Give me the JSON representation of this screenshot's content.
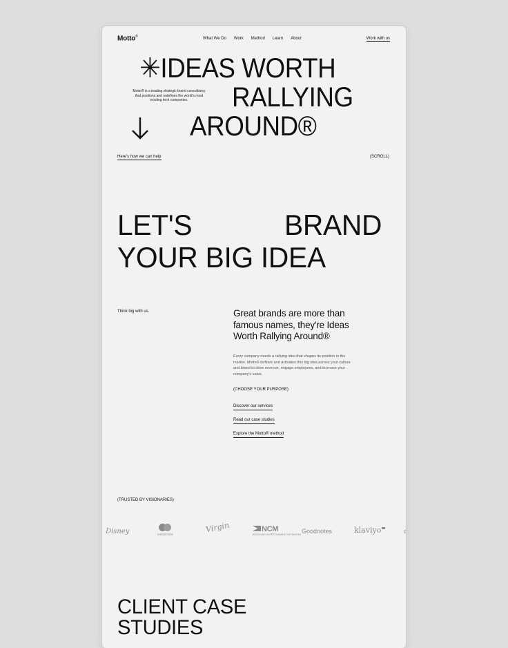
{
  "header": {
    "logo": "Motto",
    "logo_mark": "®",
    "nav": [
      "What We Do",
      "Work",
      "Method",
      "Learn",
      "About"
    ],
    "cta": "Work with us"
  },
  "hero": {
    "asterisk": "✳",
    "line1": "IDEAS WORTH",
    "line2": "RALLYING",
    "line3": "AROUND®",
    "blurb": "Motto® is a leading strategic brand consultancy that positions and redefines the world's most exciting tech companies.",
    "help_link": "Here's how we can help",
    "scroll": "(SCROLL)"
  },
  "brand_section": {
    "line1a": "LET'S",
    "line1b": "BRAND",
    "line2": "YOUR BIG IDEA",
    "tagline": "Think big with us.",
    "lead": "Great brands are more than famous names, they're Ideas Worth Rallying Around®",
    "body": "Every company needs a rallying idea that shapes its position in the market. Motto® defines and activates this big idea across your culture and brand to drive revenue, engage employees, and increase your company's value.",
    "purpose_label": "(CHOOSE YOUR PURPOSE)",
    "links": [
      "Discover our services",
      "Read our case studies",
      "Explore the Motto® method"
    ]
  },
  "trusted": {
    "label": "(TRUSTED BY VISIONARIES)",
    "logos": {
      "disney": "Disney",
      "mastercard": "mastercard",
      "virgin": "Virgin",
      "ncm": "NCM",
      "ncm_sub": "ENGAGING ENTERTAINMENT NETWORKS",
      "goodnotes": "Goodnotes",
      "klaviyo": "klaviyo",
      "edge": "c"
    }
  },
  "case_studies": {
    "line1": "CLIENT CASE",
    "line2": "STUDIES"
  },
  "colors": {
    "background": "#dedede",
    "page": "#f2f2f2",
    "text": "#111111",
    "muted": "#8a8a8a"
  }
}
